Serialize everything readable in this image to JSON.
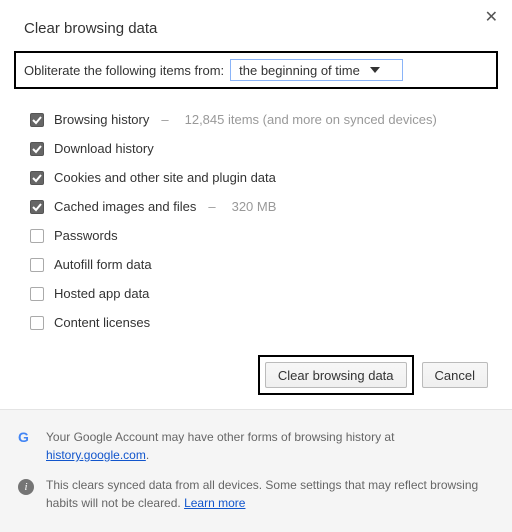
{
  "dialog": {
    "title": "Clear browsing data",
    "obliterate_label": "Obliterate the following items from:",
    "range_selected": "the beginning of time"
  },
  "options": [
    {
      "key": "browsing-history",
      "checked": true,
      "label": "Browsing history",
      "suffix": "12,845 items (and more on synced devices)"
    },
    {
      "key": "download-history",
      "checked": true,
      "label": "Download history",
      "suffix": ""
    },
    {
      "key": "cookies",
      "checked": true,
      "label": "Cookies and other site and plugin data",
      "suffix": ""
    },
    {
      "key": "cached",
      "checked": true,
      "label": "Cached images and files",
      "suffix": "320 MB"
    },
    {
      "key": "passwords",
      "checked": false,
      "label": "Passwords",
      "suffix": ""
    },
    {
      "key": "autofill",
      "checked": false,
      "label": "Autofill form data",
      "suffix": ""
    },
    {
      "key": "hosted-app",
      "checked": false,
      "label": "Hosted app data",
      "suffix": ""
    },
    {
      "key": "content-licenses",
      "checked": false,
      "label": "Content licenses",
      "suffix": ""
    }
  ],
  "buttons": {
    "clear": "Clear browsing data",
    "cancel": "Cancel"
  },
  "footer": {
    "line1_pre": "Your Google Account may have other forms of browsing history at ",
    "line1_link": "history.google.com",
    "line1_post": ".",
    "line2_pre": "This clears synced data from all devices. Some settings that may reflect browsing habits will not be cleared. ",
    "line2_link": "Learn more"
  }
}
